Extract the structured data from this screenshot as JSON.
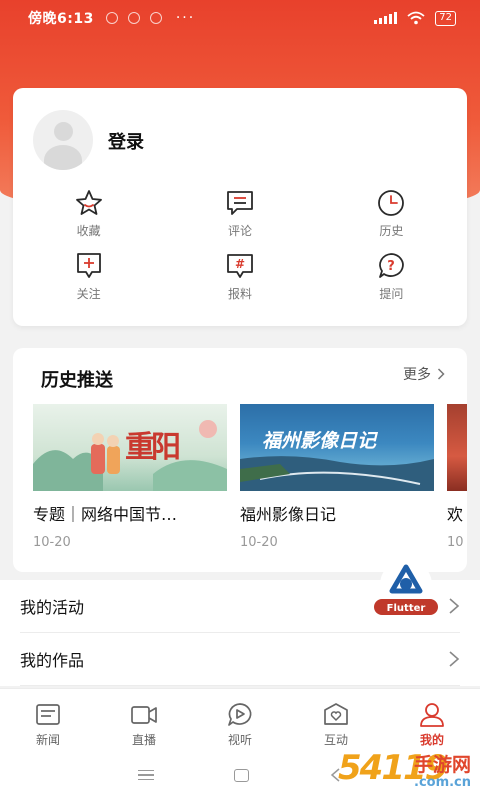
{
  "status_bar": {
    "time": "傍晚6:13",
    "more": "···",
    "battery": "72"
  },
  "profile": {
    "login_label": "登录",
    "actions": [
      {
        "label": "收藏",
        "icon": "star-icon"
      },
      {
        "label": "评论",
        "icon": "comment-icon"
      },
      {
        "label": "历史",
        "icon": "clock-icon"
      },
      {
        "label": "关注",
        "icon": "follow-icon"
      },
      {
        "label": "报料",
        "icon": "hashtag-icon"
      },
      {
        "label": "提问",
        "icon": "question-icon"
      }
    ]
  },
  "history": {
    "title": "历史推送",
    "more_label": "更多",
    "items": [
      {
        "title": "专题｜网络中国节…",
        "date": "10-20",
        "thumb_text": "重阳"
      },
      {
        "title": "福州影像日记",
        "date": "10-20",
        "thumb_text": "福州影像日记"
      },
      {
        "title": "欢",
        "date": "10"
      }
    ]
  },
  "menu": {
    "items": [
      {
        "label": "我的活动"
      },
      {
        "label": "我的作品"
      }
    ]
  },
  "badge": {
    "label": "Flutter"
  },
  "tabs": [
    {
      "label": "新闻",
      "icon": "news-icon",
      "active": false
    },
    {
      "label": "直播",
      "icon": "live-video-icon",
      "active": false
    },
    {
      "label": "视听",
      "icon": "play-icon",
      "active": false
    },
    {
      "label": "互动",
      "icon": "interact-icon",
      "active": false
    },
    {
      "label": "我的",
      "icon": "profile-icon",
      "active": true
    }
  ],
  "watermark": {
    "main": "54119",
    "sub": "手游网",
    "url": ".com.cn"
  },
  "colors": {
    "brand": "#e8412c",
    "active_tab": "#d93b2e",
    "icon_stroke": "#b5402f"
  }
}
